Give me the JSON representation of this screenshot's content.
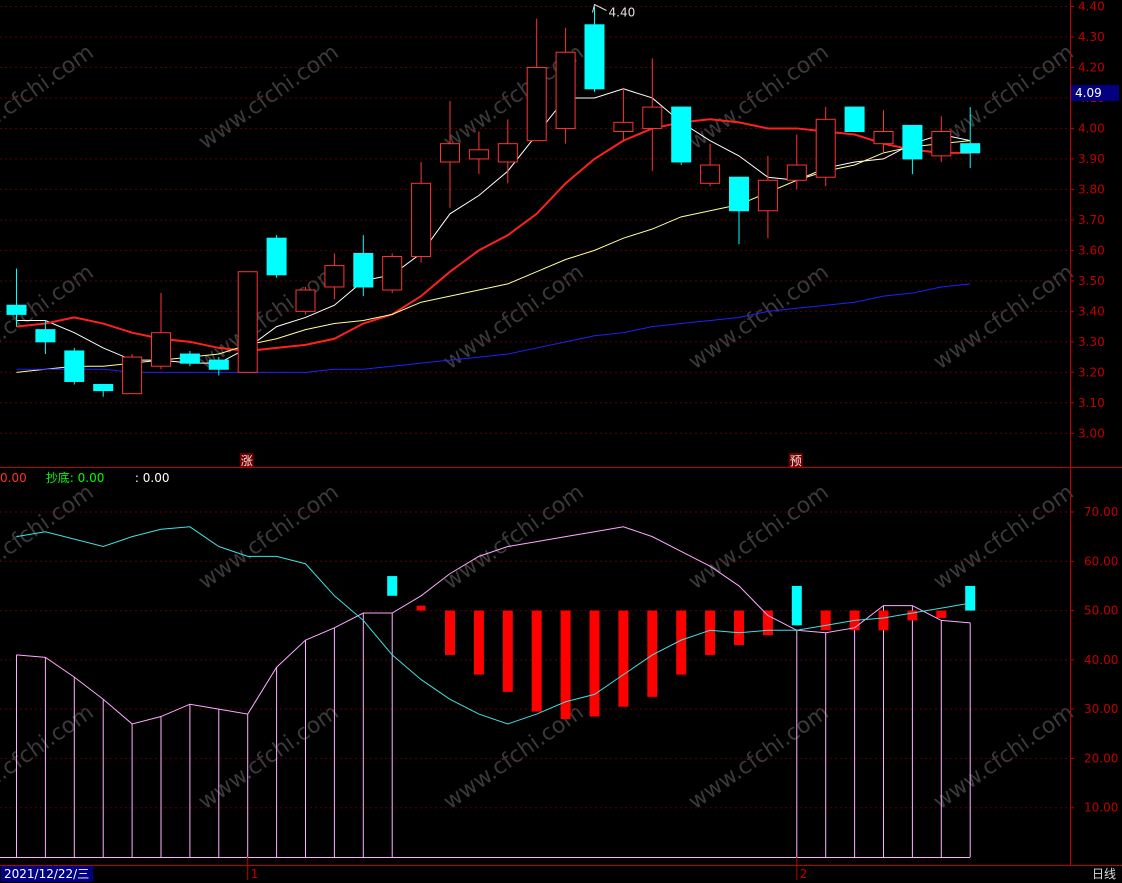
{
  "chart_data": [
    {
      "type": "candlestick",
      "ylim": [
        2.9,
        4.42
      ],
      "y_ticks": [
        "3.00",
        "3.10",
        "3.20",
        "3.30",
        "3.40",
        "3.50",
        "3.60",
        "3.70",
        "3.80",
        "3.90",
        "4.00",
        "4.10",
        "4.20",
        "4.30",
        "4.40"
      ],
      "max_label": "4.40",
      "current_price": "4.09",
      "markers": [
        {
          "index": 8,
          "text": "涨"
        },
        {
          "index": 27,
          "text": "预"
        }
      ],
      "candles": [
        {
          "o": 3.42,
          "c": 3.39,
          "h": 3.54,
          "l": 3.35
        },
        {
          "o": 3.34,
          "c": 3.3,
          "h": 3.37,
          "l": 3.26
        },
        {
          "o": 3.27,
          "c": 3.17,
          "h": 3.28,
          "l": 3.16
        },
        {
          "o": 3.16,
          "c": 3.14,
          "h": 3.16,
          "l": 3.12
        },
        {
          "o": 3.13,
          "c": 3.25,
          "h": 3.26,
          "l": 3.13
        },
        {
          "o": 3.22,
          "c": 3.33,
          "h": 3.46,
          "l": 3.21
        },
        {
          "o": 3.26,
          "c": 3.23,
          "h": 3.27,
          "l": 3.22
        },
        {
          "o": 3.24,
          "c": 3.21,
          "h": 3.25,
          "l": 3.19
        },
        {
          "o": 3.2,
          "c": 3.53,
          "h": 3.53,
          "l": 3.2
        },
        {
          "o": 3.64,
          "c": 3.52,
          "h": 3.65,
          "l": 3.51
        },
        {
          "o": 3.4,
          "c": 3.47,
          "h": 3.48,
          "l": 3.39
        },
        {
          "o": 3.48,
          "c": 3.55,
          "h": 3.59,
          "l": 3.44
        },
        {
          "o": 3.59,
          "c": 3.48,
          "h": 3.65,
          "l": 3.45
        },
        {
          "o": 3.47,
          "c": 3.58,
          "h": 3.59,
          "l": 3.46
        },
        {
          "o": 3.58,
          "c": 3.82,
          "h": 3.89,
          "l": 3.56
        },
        {
          "o": 3.89,
          "c": 3.95,
          "h": 4.09,
          "l": 3.74
        },
        {
          "o": 3.9,
          "c": 3.93,
          "h": 3.99,
          "l": 3.85
        },
        {
          "o": 3.89,
          "c": 3.95,
          "h": 4.03,
          "l": 3.82
        },
        {
          "o": 3.96,
          "c": 4.2,
          "h": 4.36,
          "l": 3.96
        },
        {
          "o": 4.0,
          "c": 4.25,
          "h": 4.33,
          "l": 3.95
        },
        {
          "o": 4.34,
          "c": 4.13,
          "h": 4.4,
          "l": 4.12
        },
        {
          "o": 3.99,
          "c": 4.02,
          "h": 4.13,
          "l": 3.96
        },
        {
          "o": 4.0,
          "c": 4.07,
          "h": 4.23,
          "l": 3.86
        },
        {
          "o": 4.07,
          "c": 3.89,
          "h": 4.07,
          "l": 3.88
        },
        {
          "o": 3.82,
          "c": 3.88,
          "h": 3.95,
          "l": 3.81
        },
        {
          "o": 3.84,
          "c": 3.73,
          "h": 3.84,
          "l": 3.62
        },
        {
          "o": 3.73,
          "c": 3.83,
          "h": 3.91,
          "l": 3.64
        },
        {
          "o": 3.83,
          "c": 3.88,
          "h": 3.98,
          "l": 3.8
        },
        {
          "o": 3.84,
          "c": 4.03,
          "h": 4.07,
          "l": 3.81
        },
        {
          "o": 4.07,
          "c": 3.99,
          "h": 4.07,
          "l": 3.99
        },
        {
          "o": 3.95,
          "c": 3.99,
          "h": 4.06,
          "l": 3.92
        },
        {
          "o": 4.01,
          "c": 3.9,
          "h": 4.01,
          "l": 3.85
        },
        {
          "o": 3.91,
          "c": 3.99,
          "h": 4.04,
          "l": 3.89
        },
        {
          "o": 3.95,
          "c": 3.92,
          "h": 4.07,
          "l": 3.87
        }
      ],
      "ma": [
        {
          "color": "#ffffff",
          "values": [
            3.37,
            3.37,
            3.33,
            3.28,
            3.24,
            3.24,
            3.23,
            3.23,
            3.28,
            3.35,
            3.38,
            3.42,
            3.5,
            3.52,
            3.59,
            3.72,
            3.78,
            3.86,
            3.98,
            4.1,
            4.1,
            4.13,
            4.1,
            4.02,
            3.96,
            3.91,
            3.84,
            3.83,
            3.87,
            3.89,
            3.9,
            3.95,
            3.98,
            3.96
          ]
        },
        {
          "color": "#ff2020",
          "values": [
            3.35,
            3.36,
            3.38,
            3.36,
            3.33,
            3.31,
            3.3,
            3.28,
            3.27,
            3.28,
            3.29,
            3.31,
            3.36,
            3.39,
            3.45,
            3.53,
            3.6,
            3.65,
            3.72,
            3.82,
            3.9,
            3.96,
            4.0,
            4.02,
            4.03,
            4.02,
            4.0,
            4.0,
            3.99,
            3.98,
            3.95,
            3.93,
            3.92,
            3.92
          ]
        },
        {
          "color": "#ffff99",
          "values": [
            3.2,
            3.21,
            3.22,
            3.22,
            3.23,
            3.24,
            3.25,
            3.26,
            3.29,
            3.31,
            3.34,
            3.36,
            3.37,
            3.39,
            3.43,
            3.45,
            3.47,
            3.49,
            3.53,
            3.57,
            3.6,
            3.64,
            3.67,
            3.71,
            3.73,
            3.75,
            3.79,
            3.83,
            3.86,
            3.88,
            3.92,
            3.94,
            3.95,
            3.96
          ]
        },
        {
          "color": "#2020ff",
          "values": [
            3.21,
            3.21,
            3.21,
            3.21,
            3.2,
            3.2,
            3.2,
            3.2,
            3.2,
            3.2,
            3.2,
            3.21,
            3.21,
            3.22,
            3.23,
            3.24,
            3.25,
            3.26,
            3.28,
            3.3,
            3.32,
            3.33,
            3.35,
            3.36,
            3.37,
            3.38,
            3.4,
            3.41,
            3.42,
            3.43,
            3.45,
            3.46,
            3.48,
            3.49
          ]
        }
      ]
    },
    {
      "type": "bar+line",
      "ylim": [
        0,
        73
      ],
      "y_ticks": [
        "10.00",
        "20.00",
        "30.00",
        "40.00",
        "50.00",
        "60.00",
        "70.00"
      ],
      "legend": [
        {
          "text": "0.00",
          "color": "#ff3030"
        },
        {
          "text": "抄底: 0.00",
          "color": "#00ff00"
        },
        {
          "text": ": 0.00",
          "color": "#ffffff"
        }
      ],
      "line_cyan": [
        65,
        66,
        64.5,
        63,
        65,
        66.5,
        67,
        63,
        61,
        61,
        59.5,
        53,
        48,
        41,
        36,
        32,
        29,
        27,
        29,
        31.5,
        33,
        37,
        41,
        44,
        46,
        45.5,
        46,
        46,
        47,
        48,
        48.5,
        49.5,
        50.5,
        51.5
      ],
      "line_pink": [
        41,
        40.5,
        36.5,
        32,
        27,
        28.5,
        31,
        30,
        29,
        38.5,
        44,
        46.5,
        49.5,
        49.5,
        53,
        57.5,
        61,
        63,
        64,
        65,
        66,
        67,
        65,
        62,
        59,
        55,
        49,
        46,
        45.5,
        46.5,
        51,
        51,
        48,
        47.5
      ],
      "histogram": [
        {
          "i": 13,
          "from": 57,
          "to": 53
        },
        {
          "i": 14,
          "from": 51,
          "to": 50
        },
        {
          "i": 15,
          "from": 50,
          "to": 41
        },
        {
          "i": 16,
          "from": 50,
          "to": 37
        },
        {
          "i": 17,
          "from": 50,
          "to": 33.5
        },
        {
          "i": 18,
          "from": 50,
          "to": 29.5
        },
        {
          "i": 19,
          "from": 50,
          "to": 28
        },
        {
          "i": 20,
          "from": 50,
          "to": 28.5
        },
        {
          "i": 21,
          "from": 50,
          "to": 30.5
        },
        {
          "i": 22,
          "from": 50,
          "to": 32.5
        },
        {
          "i": 23,
          "from": 50,
          "to": 37
        },
        {
          "i": 24,
          "from": 50,
          "to": 41
        },
        {
          "i": 25,
          "from": 50,
          "to": 43
        },
        {
          "i": 26,
          "from": 50,
          "to": 45
        },
        {
          "i": 27,
          "from": 55,
          "to": 47
        },
        {
          "i": 28,
          "from": 50,
          "to": 46
        },
        {
          "i": 29,
          "from": 50,
          "to": 46
        },
        {
          "i": 30,
          "from": 50,
          "to": 46
        },
        {
          "i": 31,
          "from": 50,
          "to": 48
        },
        {
          "i": 32,
          "from": 50,
          "to": 48.5
        },
        {
          "i": 33,
          "from": 50,
          "to": 55
        }
      ],
      "drop_lines": [
        {
          "from": 0,
          "to": 13
        },
        {
          "from": 27,
          "to": 33
        }
      ]
    }
  ],
  "footer": {
    "date": "2021/12/22/三",
    "month_marks": [
      {
        "index": 8,
        "text": "1"
      },
      {
        "index": 27,
        "text": "2"
      }
    ],
    "period": "日线"
  },
  "watermark": "www.cfchi.com"
}
